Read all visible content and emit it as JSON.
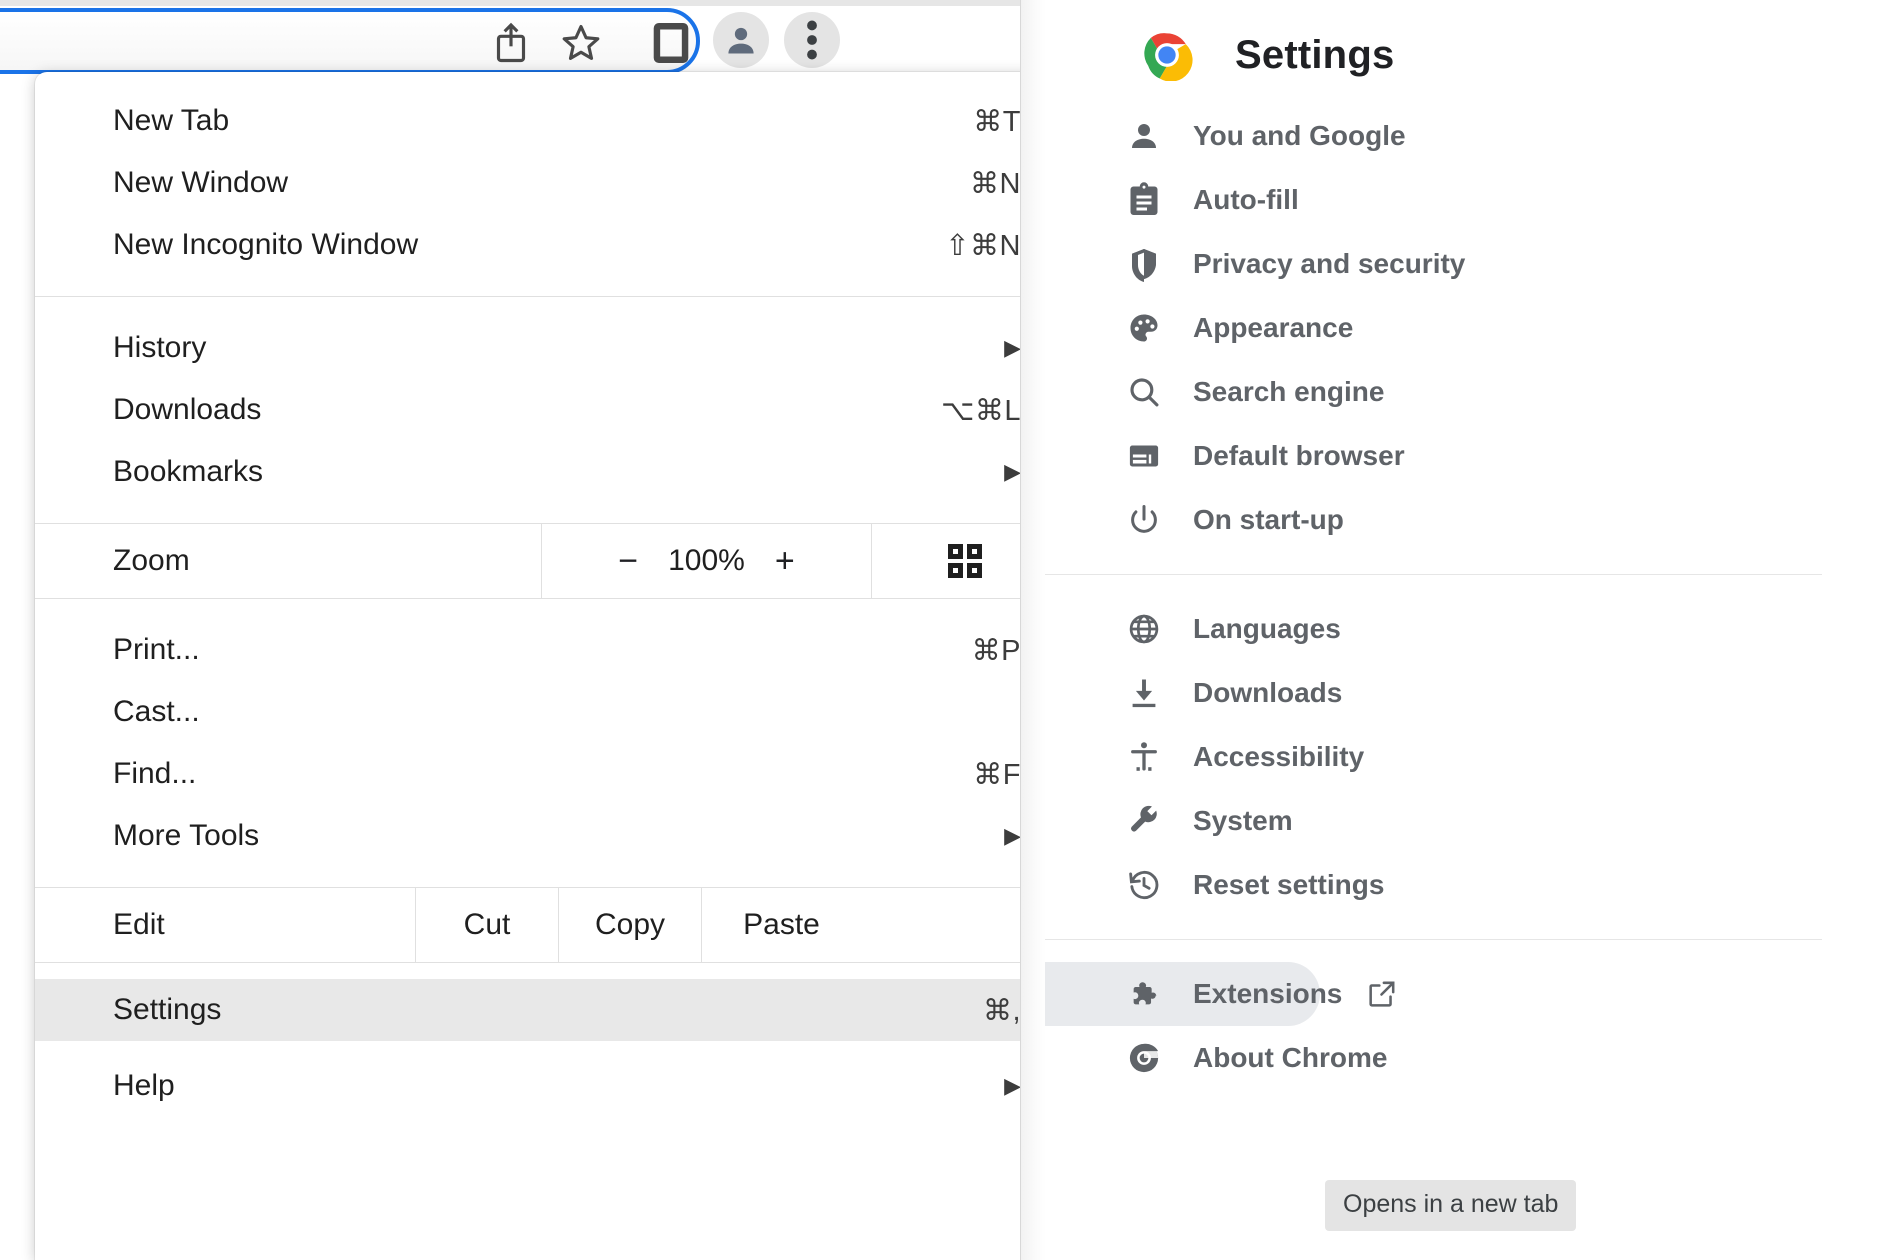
{
  "toolbar": {
    "icons": [
      {
        "name": "share-icon",
        "label": "Share"
      },
      {
        "name": "bookmark-star-icon",
        "label": "Bookmark this tab"
      },
      {
        "name": "side-panel-icon",
        "label": "Side panel"
      },
      {
        "name": "profile-avatar-icon",
        "label": "Profile"
      },
      {
        "name": "three-dot-menu-icon",
        "label": "Customise and control Google Chrome"
      }
    ],
    "accent_color": "#1a73e8"
  },
  "menu": {
    "groups": [
      {
        "items": [
          {
            "label": "New Tab",
            "accel": "⌘T",
            "arrow": false
          },
          {
            "label": "New Window",
            "accel": "⌘N",
            "arrow": false
          },
          {
            "label": "New Incognito Window",
            "accel": "⇧⌘N",
            "arrow": false
          }
        ]
      },
      {
        "items": [
          {
            "label": "History",
            "accel": "",
            "arrow": true
          },
          {
            "label": "Downloads",
            "accel": "⌥⌘L",
            "arrow": false
          },
          {
            "label": "Bookmarks",
            "accel": "",
            "arrow": true
          }
        ]
      },
      {
        "zoom_row": {
          "label": "Zoom",
          "minus": "−",
          "value": "100%",
          "plus": "+",
          "fullscreen_icon": "fullscreen-icon"
        }
      },
      {
        "items": [
          {
            "label": "Print...",
            "accel": "⌘P",
            "arrow": false
          },
          {
            "label": "Cast...",
            "accel": "",
            "arrow": false
          },
          {
            "label": "Find...",
            "accel": "⌘F",
            "arrow": false
          },
          {
            "label": "More Tools",
            "accel": "",
            "arrow": true
          }
        ]
      },
      {
        "edit_row": {
          "label": "Edit",
          "cut": "Cut",
          "copy": "Copy",
          "paste": "Paste"
        }
      },
      {
        "items": [
          {
            "label": "Settings",
            "accel": "⌘,",
            "arrow": false,
            "highlight": true
          },
          {
            "label": "Help",
            "accel": "",
            "arrow": true
          }
        ]
      }
    ],
    "highlight_color": "#e8e8e8"
  },
  "settings": {
    "title": "Settings",
    "logo": "chrome-logo",
    "groups": [
      {
        "items": [
          {
            "label": "You and Google",
            "icon": "person-icon"
          },
          {
            "label": "Auto-fill",
            "icon": "clipboard-icon"
          },
          {
            "label": "Privacy and security",
            "icon": "shield-icon"
          },
          {
            "label": "Appearance",
            "icon": "palette-icon"
          },
          {
            "label": "Search engine",
            "icon": "search-icon"
          },
          {
            "label": "Default browser",
            "icon": "browser-window-icon"
          },
          {
            "label": "On start-up",
            "icon": "power-icon"
          }
        ]
      },
      {
        "items": [
          {
            "label": "Languages",
            "icon": "globe-icon"
          },
          {
            "label": "Downloads",
            "icon": "download-icon"
          },
          {
            "label": "Accessibility",
            "icon": "accessibility-icon"
          },
          {
            "label": "System",
            "icon": "wrench-icon"
          },
          {
            "label": "Reset settings",
            "icon": "history-restore-icon"
          }
        ]
      },
      {
        "items": [
          {
            "label": "Extensions",
            "icon": "puzzle-icon",
            "external": true,
            "selected": true
          },
          {
            "label": "About Chrome",
            "icon": "chrome-circle-icon"
          }
        ]
      }
    ],
    "tooltip": "Opens in a new tab",
    "selected_bg": "#e8eaed",
    "text_color": "#5f6368"
  }
}
